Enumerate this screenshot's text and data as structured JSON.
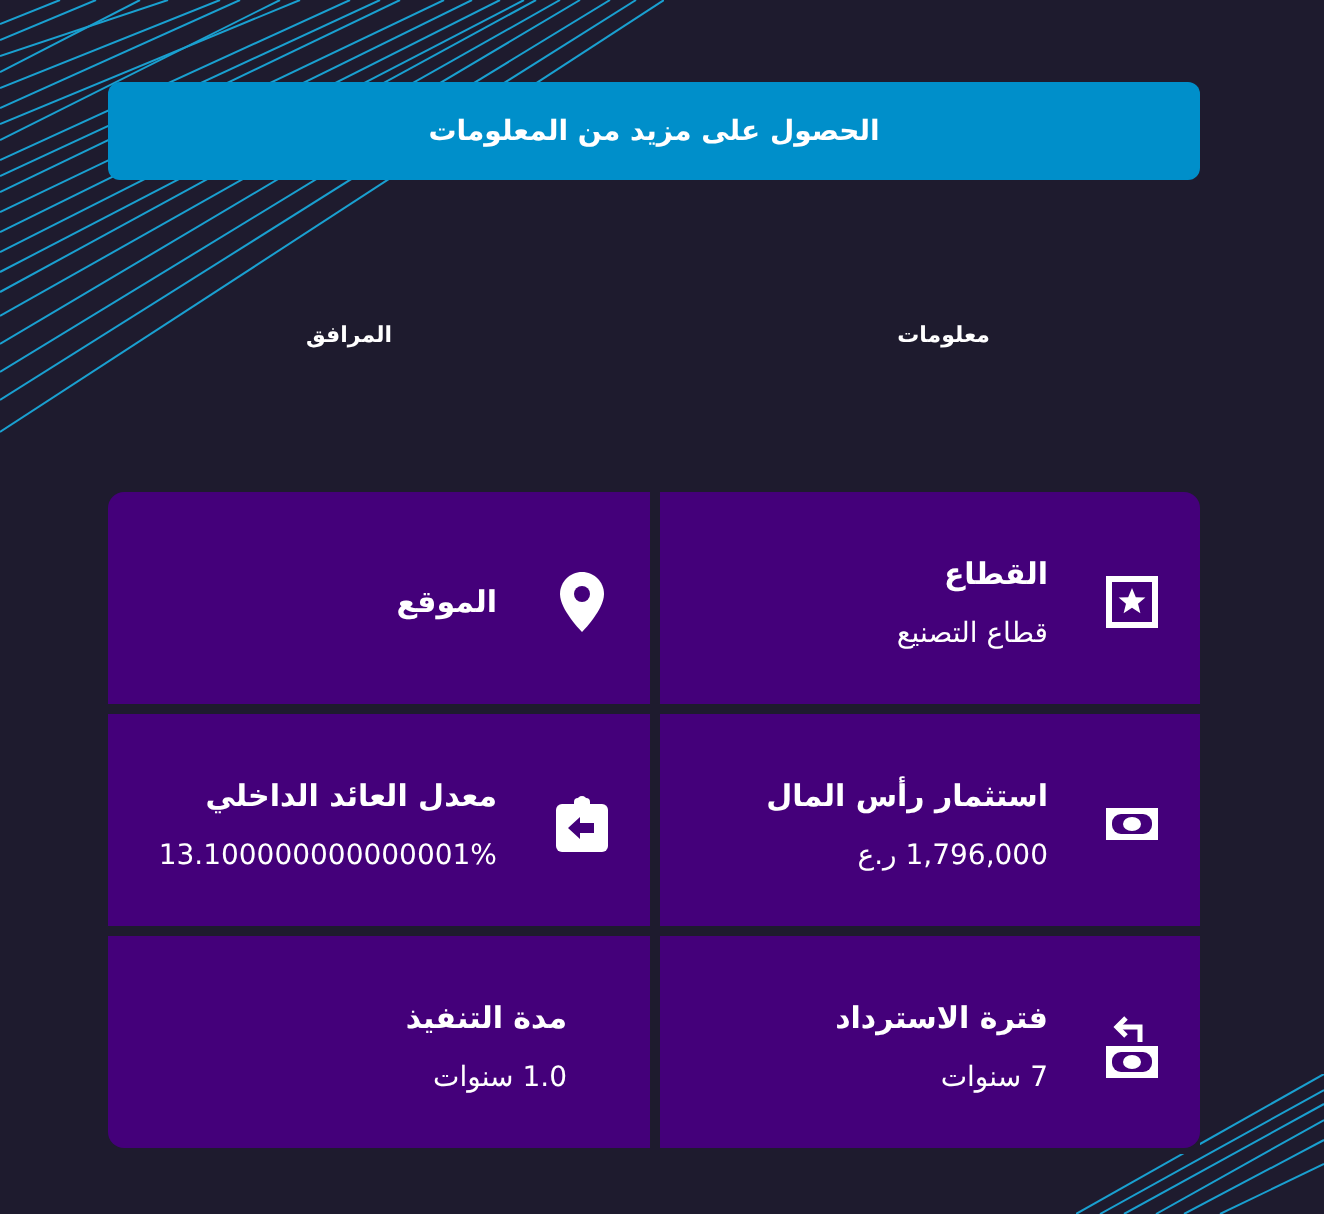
{
  "cta_button": {
    "label": "الحصول على مزيد من المعلومات"
  },
  "tabs": [
    {
      "label": "معلومات"
    },
    {
      "label": "المرافق"
    }
  ],
  "cards": [
    {
      "kind": "sector",
      "title": "القطاع",
      "value": "قطاع التصنيع"
    },
    {
      "kind": "location",
      "title": "الموقع"
    },
    {
      "kind": "investment",
      "title": "استثمار رأس المال",
      "value": "1,796,000 ر.ع"
    },
    {
      "kind": "return",
      "title": "معدل العائد الداخلي",
      "value": "13.100000000000001%"
    },
    {
      "kind": "payback",
      "title": "فترة الاسترداد",
      "value": "7 سنوات"
    },
    {
      "kind": "duration",
      "title": "مدة التنفيذ",
      "value": "1.0 سنوات"
    }
  ]
}
